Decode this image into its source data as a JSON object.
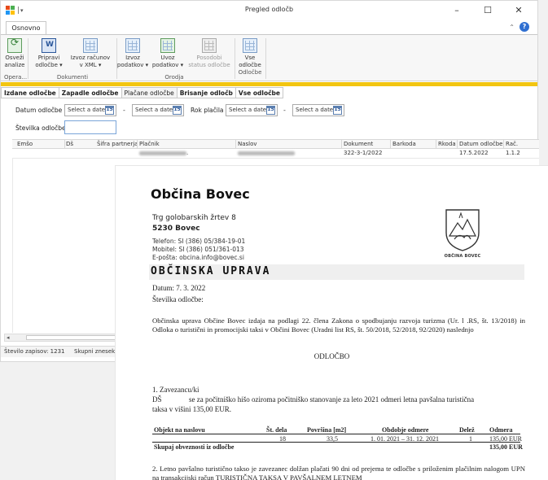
{
  "window": {
    "title": "Pregled odločb",
    "minimize_glyph": "–",
    "maximize_glyph": "☐",
    "close_glyph": "✕"
  },
  "ribbon_tab": "Osnovno",
  "help_glyph": "?",
  "collapse_glyph": "⌃",
  "ribbon": {
    "buttons": [
      {
        "line1": "Osveži",
        "line2": "analize",
        "icon": "refresh-icon"
      },
      {
        "line1": "Pripravi",
        "line2": "odločbe ▾",
        "icon": "word-document-icon"
      },
      {
        "line1": "Izvoz računov",
        "line2": "v XML ▾",
        "icon": "xml-export-icon"
      },
      {
        "line1": "Izvoz",
        "line2": "podatkov ▾",
        "icon": "export-icon"
      },
      {
        "line1": "Uvoz",
        "line2": "podatkov ▾",
        "icon": "import-icon"
      },
      {
        "line1": "Posodobi",
        "line2": "status odločbe",
        "icon": "update-status-icon"
      },
      {
        "line1": "Vse",
        "line2": "odločbe",
        "line3": "Odločbe",
        "icon": "all-decisions-icon"
      }
    ],
    "groups": [
      "Opera...",
      "Dokumenti",
      "Orodja"
    ]
  },
  "subtabs": [
    "Izdane odločbe",
    "Zapadle odločbe",
    "Plačane odločbe",
    "Brisanje odločb",
    "Vse odločbe"
  ],
  "filters": {
    "datum_label": "Datum odločbe",
    "rok_label": "Rok plačila",
    "stevilka_label": "Številka odločbe",
    "date_placeholder": "Select a date",
    "cal_text": "15",
    "dash": "-"
  },
  "grid": {
    "columns": [
      "Emšo",
      "Dš",
      "Šifra partnerja",
      "Plačnik",
      "Naslov",
      "Dokument",
      "Barkoda",
      "Rkoda",
      "Datum odločbe",
      "Rač."
    ],
    "rows": [
      {
        "dokument": "322-3-1/2022",
        "datum": "17.5.2022",
        "rac": "1.1.2",
        "placnik_suffix": "."
      }
    ]
  },
  "scroll": {
    "left_glyph": "◂"
  },
  "status": {
    "records": "Število zapisov: 1231",
    "total": "Skupni znesek:"
  },
  "document": {
    "municipality": "Občina Bovec",
    "address1": "Trg golobarskih žrtev 8",
    "address2": "5230 Bovec",
    "phone": "Telefon: SI (386) 05/384-19-01",
    "mobile": "Mobitel: SI (386) 051/361-013",
    "email": "E-pošta: obcina.info@bovec.si",
    "logo_text": "OBČINA BOVEC",
    "band": "OBČINSKA UPRAVA",
    "date": "Datum: 7. 3. 2022",
    "number_label": "Številka odločbe:",
    "intro": "Občinska uprava Občine Bovec izdaja na podlagi 22. člena Zakona o spodbujanju razvoja turizma (Ur. l .RS, št. 13/2018) in Odloka o turistični in promocijski taksi v Občini Bovec (Uradni list RS, št. 50/2018, 52/2018, 92/2020) naslednjo",
    "heading": "ODLOČBO",
    "item1": "1. Zavezancu/ki",
    "ds_prefix": "DŠ",
    "item1_text": "se za počitniško hišo oziroma počitniško stanovanje za leto 2021 odmeri letna pavšalna turistična",
    "item1_text2": "taksa v višini 135,00 EUR.",
    "table": {
      "headers": [
        "Objekt na naslovu",
        "Št. dela",
        "Površina [m2]",
        "Obdobje odmere",
        "Delež",
        "Odmera"
      ],
      "row": [
        "",
        "18",
        "33,5",
        "1. 01. 2021 – 31. 12. 2021",
        "1",
        "135,00 EUR"
      ],
      "sum_label": "Skupaj obveznosti iz odločbe",
      "sum_value": "135,00 EUR"
    },
    "item2": "2. Letno pavšalno turistično takso je zavezanec dolžan plačati 90 dni od prejema te odločbe s priloženim plačilnim nalogom UPN na transakcijski račun TURISTIČNA TAKSA V PAVŠALNEM LETNEM"
  }
}
